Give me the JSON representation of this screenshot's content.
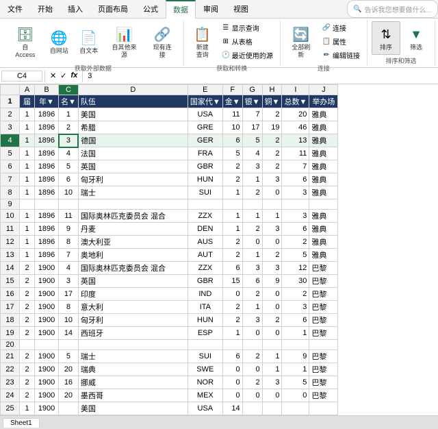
{
  "ribbon": {
    "tabs": [
      "文件",
      "开始",
      "插入",
      "页面布局",
      "公式",
      "数据",
      "审阅",
      "视图"
    ],
    "active_tab": "数据",
    "tell_me": "告诉我您想要做什么...",
    "groups": [
      {
        "label": "获取外部数据",
        "buttons": [
          {
            "label": "自 Access",
            "icon": "🗄"
          },
          {
            "label": "自网站",
            "icon": "🌐"
          },
          {
            "label": "自文本",
            "icon": "📄"
          },
          {
            "label": "自其他来源",
            "icon": "📊"
          },
          {
            "label": "现有连接",
            "icon": "🔗"
          }
        ]
      },
      {
        "label": "获取和转换",
        "buttons": [
          {
            "label": "新建\n查询",
            "icon": "📋"
          },
          {
            "label": "显示查询",
            "icon": ""
          },
          {
            "label": "从表格",
            "icon": ""
          },
          {
            "label": "最近使用的源",
            "icon": ""
          }
        ]
      },
      {
        "label": "连接",
        "buttons": [
          {
            "label": "全部刷新",
            "icon": "🔄"
          },
          {
            "label": "连接",
            "icon": ""
          },
          {
            "label": "属性",
            "icon": ""
          },
          {
            "label": "编辑链接",
            "icon": ""
          }
        ]
      },
      {
        "label": "排序和筛选",
        "buttons": [
          {
            "label": "排序",
            "icon": "⇅"
          },
          {
            "label": "筛选",
            "icon": "▼"
          }
        ]
      }
    ]
  },
  "formula_bar": {
    "cell_ref": "C4",
    "formula": "3"
  },
  "columns": [
    "A",
    "B",
    "C",
    "D",
    "E",
    "F",
    "G",
    "H",
    "I",
    "J"
  ],
  "headers": [
    "届",
    "年▼",
    "名▼",
    "队伍",
    "国家代▼",
    "金▼",
    "银▼",
    "铜▼",
    "总数▼",
    "举办场"
  ],
  "rows": [
    {
      "row": 2,
      "a": "1",
      "b": "1896",
      "c": "1",
      "d": "美国",
      "e": "USA",
      "f": "11",
      "g": "7",
      "h": "2",
      "i": "20",
      "j": "雅典"
    },
    {
      "row": 3,
      "a": "1",
      "b": "1896",
      "c": "2",
      "d": "希腊",
      "e": "GRE",
      "f": "10",
      "g": "17",
      "h": "19",
      "i": "46",
      "j": "雅典"
    },
    {
      "row": 4,
      "a": "1",
      "b": "1896",
      "c": "3",
      "d": "德国",
      "e": "GER",
      "f": "6",
      "g": "5",
      "h": "2",
      "i": "13",
      "j": "雅典",
      "active": true
    },
    {
      "row": 5,
      "a": "1",
      "b": "1896",
      "c": "4",
      "d": "法国",
      "e": "FRA",
      "f": "5",
      "g": "4",
      "h": "2",
      "i": "11",
      "j": "雅典"
    },
    {
      "row": 6,
      "a": "1",
      "b": "1896",
      "c": "5",
      "d": "英国",
      "e": "GBR",
      "f": "2",
      "g": "3",
      "h": "2",
      "i": "7",
      "j": "雅典"
    },
    {
      "row": 7,
      "a": "1",
      "b": "1896",
      "c": "6",
      "d": "匈牙利",
      "e": "HUN",
      "f": "2",
      "g": "1",
      "h": "3",
      "i": "6",
      "j": "雅典"
    },
    {
      "row": 8,
      "a": "1",
      "b": "1896",
      "c": "10",
      "d": "瑞士",
      "e": "SUI",
      "f": "1",
      "g": "2",
      "h": "0",
      "i": "3",
      "j": "雅典"
    },
    {
      "row": 9,
      "empty": true
    },
    {
      "row": 10,
      "a": "1",
      "b": "1896",
      "c": "11",
      "d": "国际奥林匹克委员会 混合",
      "e": "ZZX",
      "f": "1",
      "g": "1",
      "h": "1",
      "i": "3",
      "j": "雅典"
    },
    {
      "row": 11,
      "a": "1",
      "b": "1896",
      "c": "9",
      "d": "丹麦",
      "e": "DEN",
      "f": "1",
      "g": "2",
      "h": "3",
      "i": "6",
      "j": "雅典"
    },
    {
      "row": 12,
      "a": "1",
      "b": "1896",
      "c": "8",
      "d": "澳大利亚",
      "e": "AUS",
      "f": "2",
      "g": "0",
      "h": "0",
      "i": "2",
      "j": "雅典"
    },
    {
      "row": 13,
      "a": "1",
      "b": "1896",
      "c": "7",
      "d": "奥地利",
      "e": "AUT",
      "f": "2",
      "g": "1",
      "h": "2",
      "i": "5",
      "j": "雅典"
    },
    {
      "row": 14,
      "a": "2",
      "b": "1900",
      "c": "4",
      "d": "国际奥林匹克委员会 混合",
      "e": "ZZX",
      "f": "6",
      "g": "3",
      "h": "3",
      "i": "12",
      "j": "巴黎"
    },
    {
      "row": 15,
      "a": "2",
      "b": "1900",
      "c": "3",
      "d": "英国",
      "e": "GBR",
      "f": "15",
      "g": "6",
      "h": "9",
      "i": "30",
      "j": "巴黎"
    },
    {
      "row": 16,
      "a": "2",
      "b": "1900",
      "c": "17",
      "d": "印度",
      "e": "IND",
      "f": "0",
      "g": "2",
      "h": "0",
      "i": "2",
      "j": "巴黎"
    },
    {
      "row": 17,
      "a": "2",
      "b": "1900",
      "c": "8",
      "d": "意大利",
      "e": "ITA",
      "f": "2",
      "g": "1",
      "h": "0",
      "i": "3",
      "j": "巴黎"
    },
    {
      "row": 18,
      "a": "2",
      "b": "1900",
      "c": "10",
      "d": "匈牙利",
      "e": "HUN",
      "f": "2",
      "g": "3",
      "h": "2",
      "i": "6",
      "j": "巴黎"
    },
    {
      "row": 19,
      "a": "2",
      "b": "1900",
      "c": "14",
      "d": "西班牙",
      "e": "ESP",
      "f": "1",
      "g": "0",
      "h": "0",
      "i": "1",
      "j": "巴黎"
    },
    {
      "row": 20,
      "empty": true
    },
    {
      "row": 21,
      "a": "2",
      "b": "1900",
      "c": "5",
      "d": "瑞士",
      "e": "SUI",
      "f": "6",
      "g": "2",
      "h": "1",
      "i": "9",
      "j": "巴黎"
    },
    {
      "row": 22,
      "a": "2",
      "b": "1900",
      "c": "20",
      "d": "瑞典",
      "e": "SWE",
      "f": "0",
      "g": "0",
      "h": "1",
      "i": "1",
      "j": "巴黎"
    },
    {
      "row": 23,
      "a": "2",
      "b": "1900",
      "c": "16",
      "d": "挪威",
      "e": "NOR",
      "f": "0",
      "g": "2",
      "h": "3",
      "i": "5",
      "j": "巴黎"
    },
    {
      "row": 24,
      "a": "2",
      "b": "1900",
      "c": "20",
      "d": "墨西哥",
      "e": "MEX",
      "f": "0",
      "g": "0",
      "h": "0",
      "i": "0",
      "j": "巴黎"
    },
    {
      "row": 25,
      "a": "1",
      "b": "1900",
      "c": "",
      "d": "美国",
      "e": "USA",
      "f": "14",
      "g": "",
      "h": "",
      "i": "",
      "j": ""
    }
  ],
  "active_cell": "C4",
  "sheet_tab": "Sheet1"
}
